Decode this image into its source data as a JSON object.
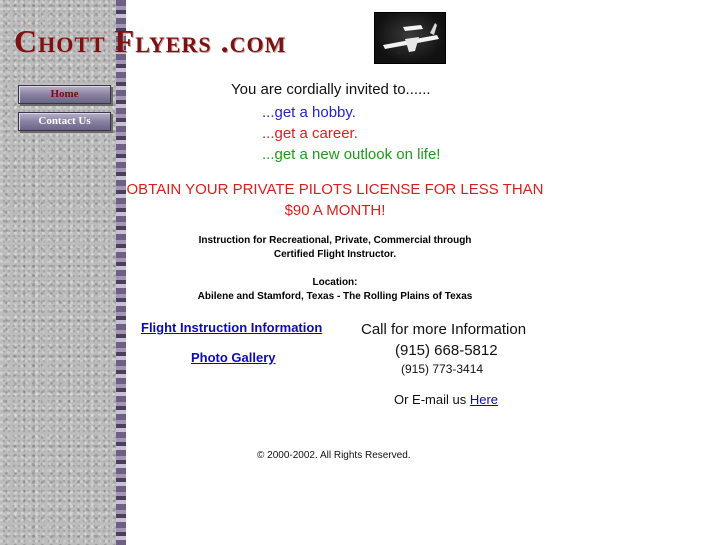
{
  "sidebar": {
    "nav": [
      {
        "label": "Home"
      },
      {
        "label": "Contact Us"
      }
    ]
  },
  "header": {
    "logo_text": "Chott Flyers .com",
    "photo_icon": "airplane-photo"
  },
  "main": {
    "invite": "You are cordially invited to......",
    "lines": [
      "...get a hobby.",
      "...get a career.",
      "...get a new outlook on life!"
    ],
    "headline": [
      "OBTAIN YOUR PRIVATE PILOTS LICENSE FOR LESS THAN",
      "$90 A MONTH!"
    ],
    "instruction": [
      "Instruction for Recreational, Private, Commercial through",
      "Certified Flight Instructor."
    ],
    "location_label": "Location:",
    "location": "Abilene and Stamford, Texas - The Rolling Plains of Texas",
    "links": {
      "flight_info": "Flight Instruction Information",
      "photo_gallery": "Photo Gallery"
    },
    "contact": {
      "call": "Call for more Information",
      "phone1": "(915) 668-5812",
      "phone2": "(915) 773-3414",
      "email_prefix": "Or E-mail us ",
      "email_link": "Here"
    },
    "copyright": "© 2000-2002.  All Rights Reserved."
  },
  "colors": {
    "logo": "#7b1212",
    "link": "#0b0bb0",
    "red": "#d81f1f",
    "green": "#1f9a1f",
    "blue": "#2424c8"
  }
}
